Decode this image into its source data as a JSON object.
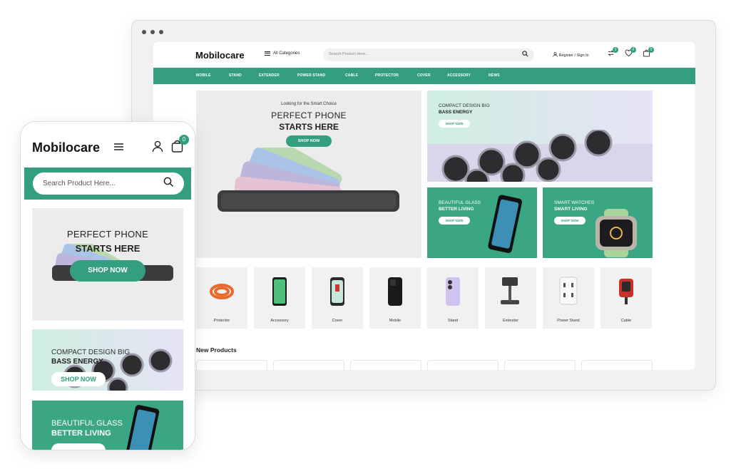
{
  "desktop": {
    "logo": "Mobilocare",
    "all_categories": "All Categories",
    "search_placeholder": "Search Product Here...",
    "register": "Register / Sign In",
    "badges": {
      "compare": "0",
      "wishlist": "0",
      "cart": "0"
    },
    "nav": [
      "MOBILE",
      "STAND",
      "EXTENDER",
      "POWER STAND",
      "CABLE",
      "PROTECTOR",
      "COVER",
      "ACCESSORY",
      "NEWS"
    ],
    "hero": {
      "kicker": "Looking for the Smart Choice",
      "line1": "PERFECT PHONE",
      "line2": "STARTS HERE",
      "cta": "SHOP NOW"
    },
    "compact": {
      "line1": "COMPACT DESIGN BIG",
      "line2": "BASS ENERGY",
      "cta": "SHOP NOW"
    },
    "glass": {
      "line1": "BEAUTIFUL GLASS",
      "line2": "BETTER LIVING",
      "cta": "SHOP NOW"
    },
    "watch": {
      "line1": "SMART WATCHES",
      "line2": "SMART LIVING",
      "cta": "SHOP NOW"
    },
    "categories": [
      "Protector",
      "Accessory",
      "Cover",
      "Mobile",
      "Stand",
      "Extender",
      "Power Stand",
      "Cable"
    ],
    "new_products": "New Products"
  },
  "mobile": {
    "logo": "Mobilocare",
    "cart_badge": "0",
    "search_placeholder": "Search Product Here...",
    "hero": {
      "line1": "PERFECT PHONE",
      "line2": "STARTS HERE",
      "cta": "SHOP NOW"
    },
    "compact": {
      "line1": "COMPACT DESIGN BIG",
      "line2": "BASS ENERGY",
      "cta": "SHOP NOW"
    },
    "glass": {
      "line1": "BEAUTIFUL GLASS",
      "line2": "BETTER LIVING"
    }
  },
  "colors": {
    "accent": "#349f80",
    "accent_light": "#cfeee0",
    "lavender": "#e6e3f6"
  },
  "icons": [
    "user-icon",
    "compare-icon",
    "heart-icon",
    "cart-icon",
    "search-icon",
    "menu-icon"
  ]
}
